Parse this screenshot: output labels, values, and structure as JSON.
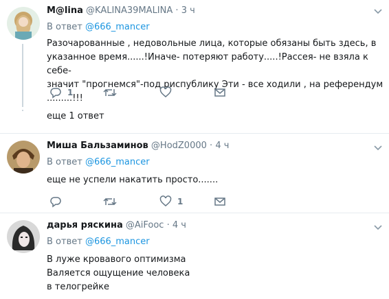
{
  "replies": [
    {
      "name": "M@lina",
      "handle": "@KALINA39MALINA",
      "time": "3 ч",
      "reply_prefix": "В ответ",
      "reply_to": "@666_mancer",
      "lines": [
        "Разочарованные , недовольные лица, которые обязаны быть здесь, в",
        "указанное время......!Иначе- потеряют работу.....!Рассея- не взяла к себе-",
        "значит \"прогнемся\"-под риспублику Эти - все ходили , на референдум .........!!!"
      ],
      "reply_count": "1",
      "like_count": "",
      "more_replies": "еще 1 ответ"
    },
    {
      "name": "Миша Бальзаминов",
      "handle": "@HodZ0000",
      "time": "4 ч",
      "reply_prefix": "В ответ",
      "reply_to": "@666_mancer",
      "lines": [
        "еще не успели накатить просто......."
      ],
      "reply_count": "",
      "like_count": "1"
    },
    {
      "name": "дарья ряскина",
      "handle": "@AiFooc",
      "time": "4 ч",
      "reply_prefix": "В ответ",
      "reply_to": "@666_mancer",
      "lines": [
        "В луже кровавого оптимизма",
        "Валяется ощущение человека",
        "в телогрейке"
      ]
    }
  ],
  "separator": "·",
  "colors": {
    "link": "#1b95e0",
    "muted": "#657786",
    "divider": "#e6ecf0"
  }
}
